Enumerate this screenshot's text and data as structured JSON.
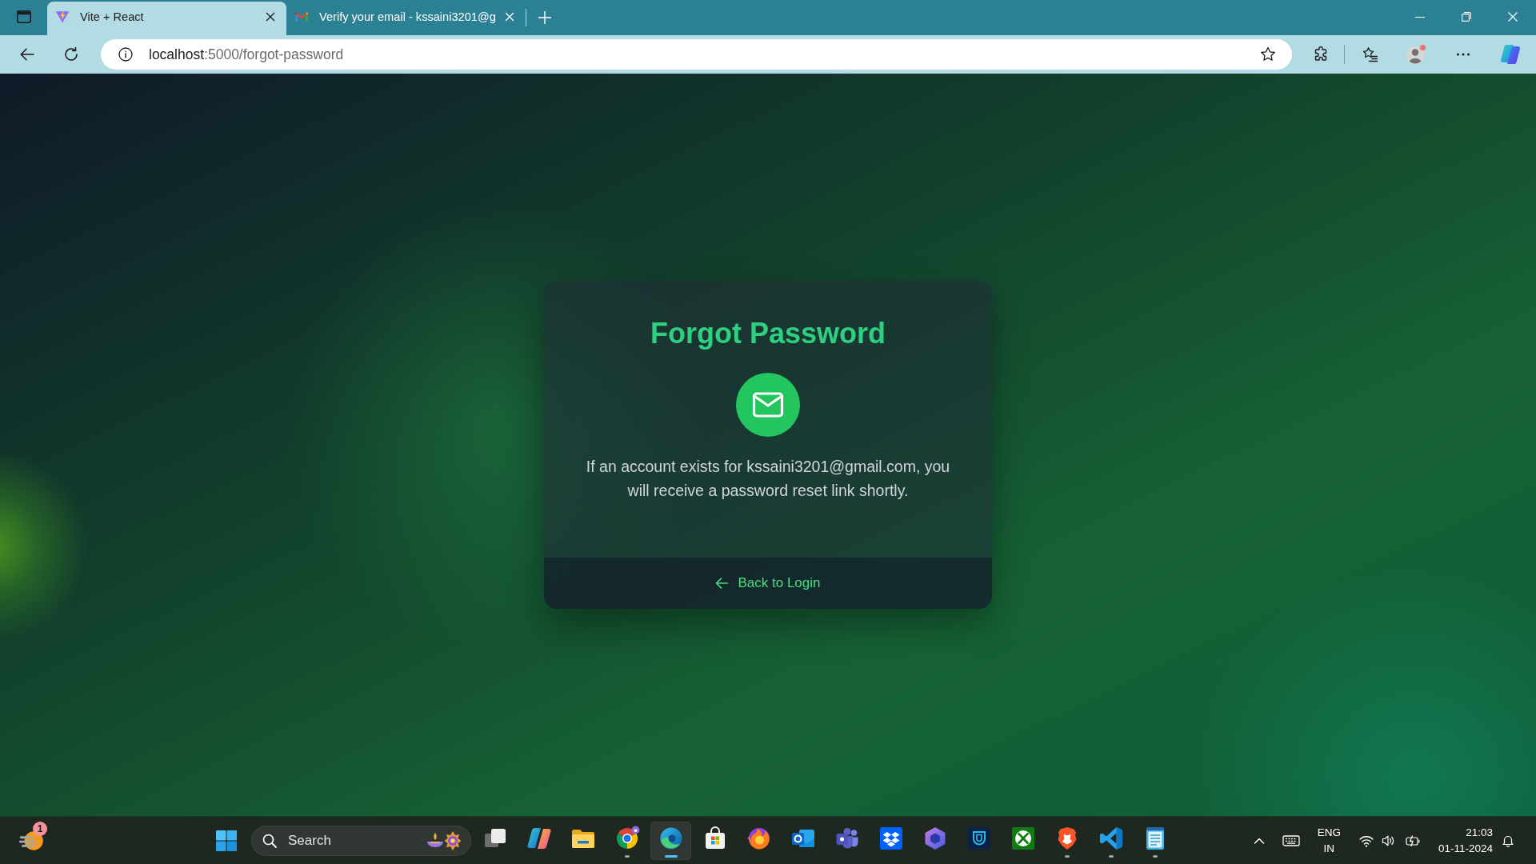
{
  "browser": {
    "tabs": [
      {
        "kind": "bolt",
        "title": "Vite + React",
        "selected": true
      },
      {
        "kind": "mail",
        "title": "Verify your email - kssaini3201@g",
        "selected": false
      }
    ],
    "address_bar": {
      "host": "localhost",
      "path": ":5000/forgot-password"
    }
  },
  "card": {
    "title": "Forgot Password",
    "message": "If an account exists for kssaini3201@gmail.com, you will receive a password reset link shortly.",
    "link": "Back to Login"
  },
  "taskbar": {
    "weather_badge": "1",
    "search": {
      "placeholder": "Search"
    },
    "apps": [
      {
        "kind": "taskview",
        "running": false,
        "selected": false
      },
      {
        "kind": "sparkle",
        "running": false,
        "selected": false
      },
      {
        "kind": "folder",
        "running": false,
        "selected": false
      },
      {
        "kind": "ring",
        "running": true,
        "selected": false
      },
      {
        "kind": "swirl",
        "running": true,
        "selected": true
      },
      {
        "kind": "bag",
        "running": false,
        "selected": false
      },
      {
        "kind": "flame",
        "running": false,
        "selected": false
      },
      {
        "kind": "mail",
        "running": false,
        "selected": false
      },
      {
        "kind": "people",
        "running": false,
        "selected": false
      },
      {
        "kind": "box",
        "running": false,
        "selected": false
      },
      {
        "kind": "hexagon",
        "running": false,
        "selected": false
      },
      {
        "kind": "vault",
        "running": false,
        "selected": false
      },
      {
        "kind": "xcircle",
        "running": false,
        "selected": false
      },
      {
        "kind": "shield",
        "running": true,
        "selected": false
      },
      {
        "kind": "ribbon",
        "running": true,
        "selected": false
      },
      {
        "kind": "notepad",
        "running": true,
        "selected": false
      }
    ],
    "tray": {
      "language": "ENG",
      "region": "IN",
      "time": "21:03",
      "date": "01-11-2024"
    }
  }
}
